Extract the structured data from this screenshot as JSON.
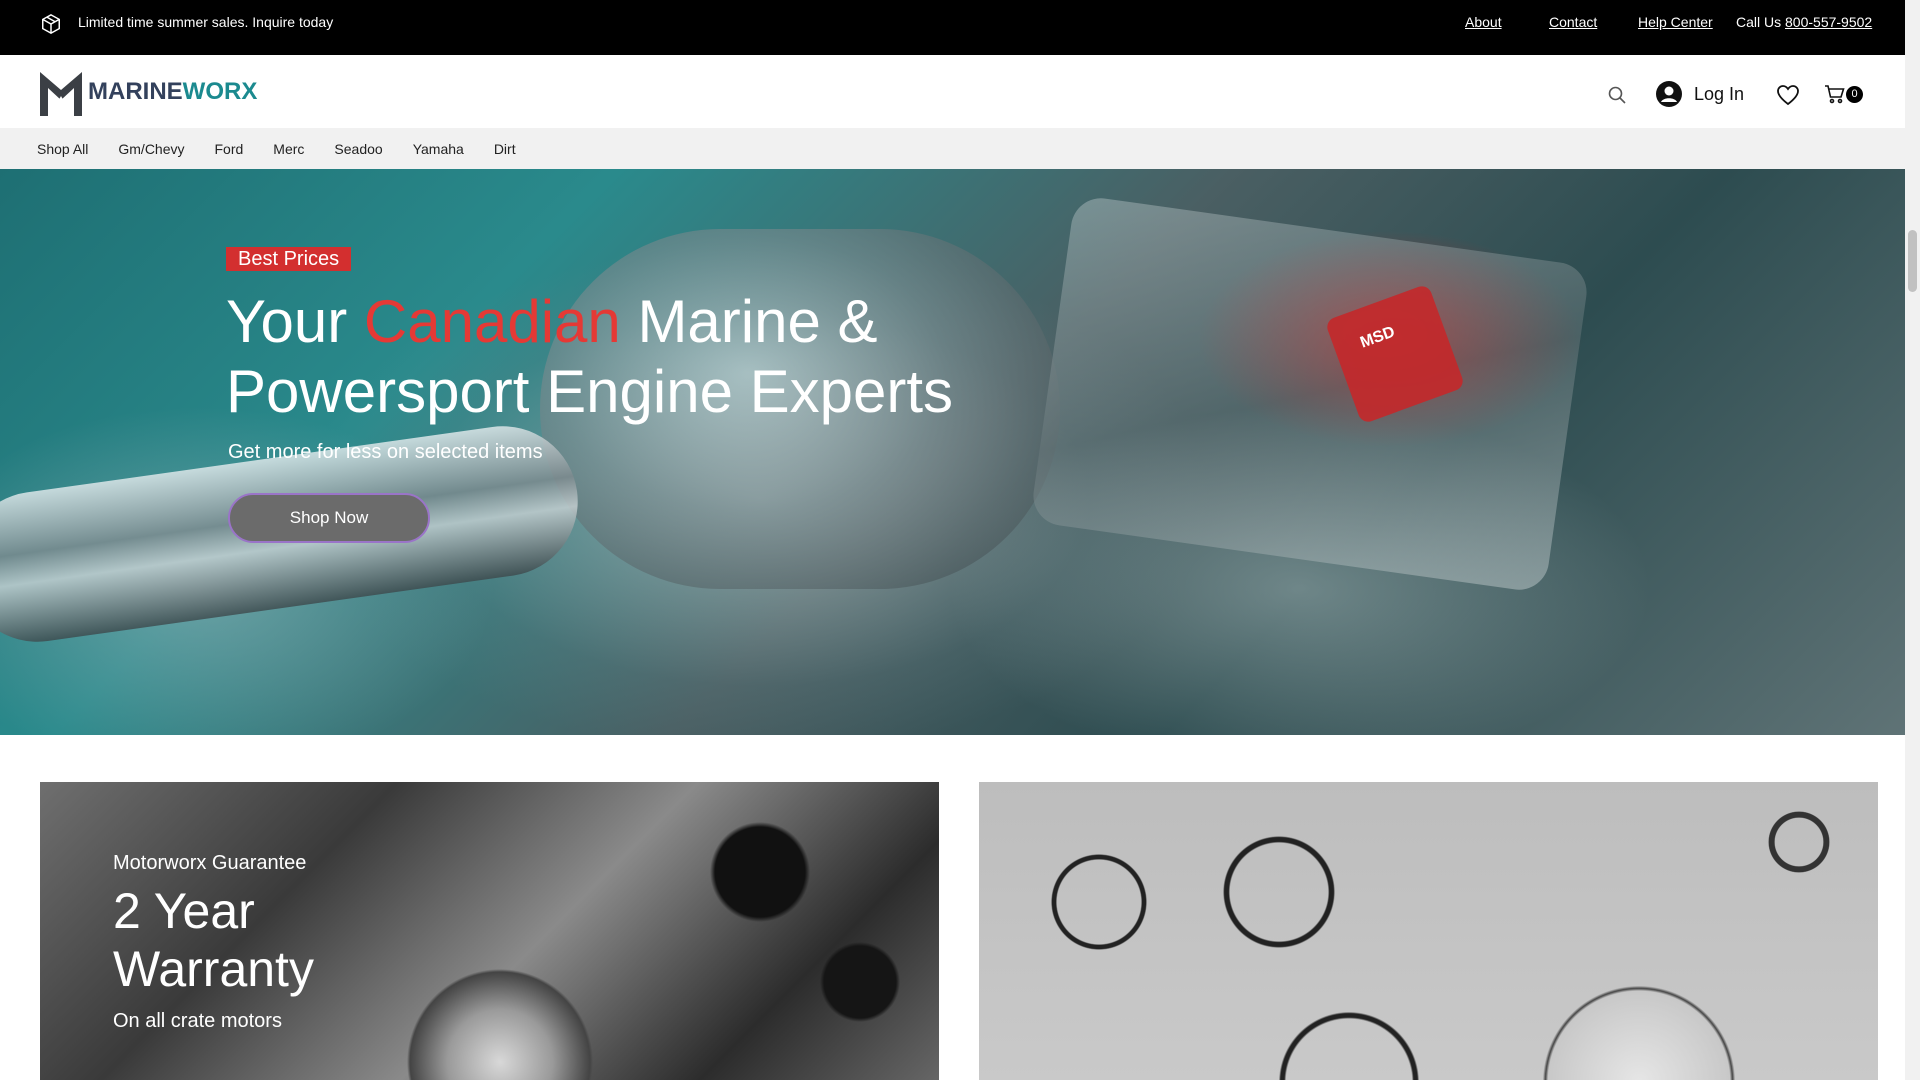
{
  "topbar": {
    "announcement": "Limited time summer sales. Inquire today",
    "about": "About",
    "contact": "Contact",
    "help_center": "Help Center",
    "call_us_label": "Call Us ",
    "phone": "800-557-9502"
  },
  "header": {
    "logo_part1": "MARINE",
    "logo_part2": "WORX",
    "login_label": "Log In",
    "cart_count": "0"
  },
  "nav": {
    "items": [
      "Shop All",
      "Gm/Chevy",
      "Ford",
      "Merc",
      "Seadoo",
      "Yamaha",
      "Dirt"
    ]
  },
  "hero": {
    "tag": "Best Prices",
    "title_pre": "Your ",
    "title_accent": "Canadian",
    "title_post": " Marine & Powersport Engine Experts",
    "subtitle": "Get more for less on selected items",
    "cta": "Shop Now",
    "coil_label": "MSD"
  },
  "cards": {
    "left": {
      "kicker": "Motorworx Guarantee",
      "title": "2 Year Warranty",
      "subtitle": "On all crate motors"
    }
  },
  "colors": {
    "accent_red": "#e53935",
    "brand_teal": "#1b8a8f",
    "brand_navy": "#33415c"
  }
}
